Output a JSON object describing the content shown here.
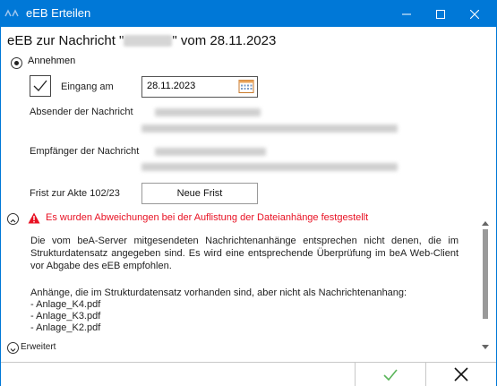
{
  "window": {
    "title": "eEB Erteilen",
    "controls": {
      "minimize": "—",
      "maximize": "☐",
      "close": "✕"
    }
  },
  "heading": {
    "prefix": "eEB zur Nachricht \"",
    "suffix": "\" vom 28.11.2023"
  },
  "radio_accept": {
    "label": "Annehmen",
    "selected": true
  },
  "eingang": {
    "label": "Eingang am",
    "checked": true,
    "date_value": "28.11.2023"
  },
  "sender": {
    "label": "Absender der Nachricht"
  },
  "recipient": {
    "label": "Empfänger der Nachricht"
  },
  "deadline": {
    "label": "Frist zur Akte 102/23",
    "button_label": "Neue Frist"
  },
  "warning": {
    "text": "Es wurden Abweichungen bei der Auflistung der Dateianhänge festgestellt",
    "color": "#e81123",
    "message": "Die vom beA-Server mitgesendeten Nachrichtenanhänge entsprechen nicht denen, die im Strukturdatensatz angegeben sind. Es wird eine entsprechende Überprüfung im beA Web-Client vor Abgabe des eEB empfohlen.",
    "attachments_intro": "Anhänge, die im Strukturdatensatz vorhanden sind, aber nicht als Nachrichtenanhang:",
    "attachments": [
      "- Anlage_K4.pdf",
      "- Anlage_K3.pdf",
      "- Anlage_K2.pdf"
    ]
  },
  "advanced": {
    "label": "Erweitert"
  },
  "footer": {
    "confirm_icon": "check-icon",
    "cancel_icon": "x-icon"
  },
  "colors": {
    "titlebar": "#0078d7",
    "confirm": "#5ab55a",
    "warning": "#e81123"
  }
}
